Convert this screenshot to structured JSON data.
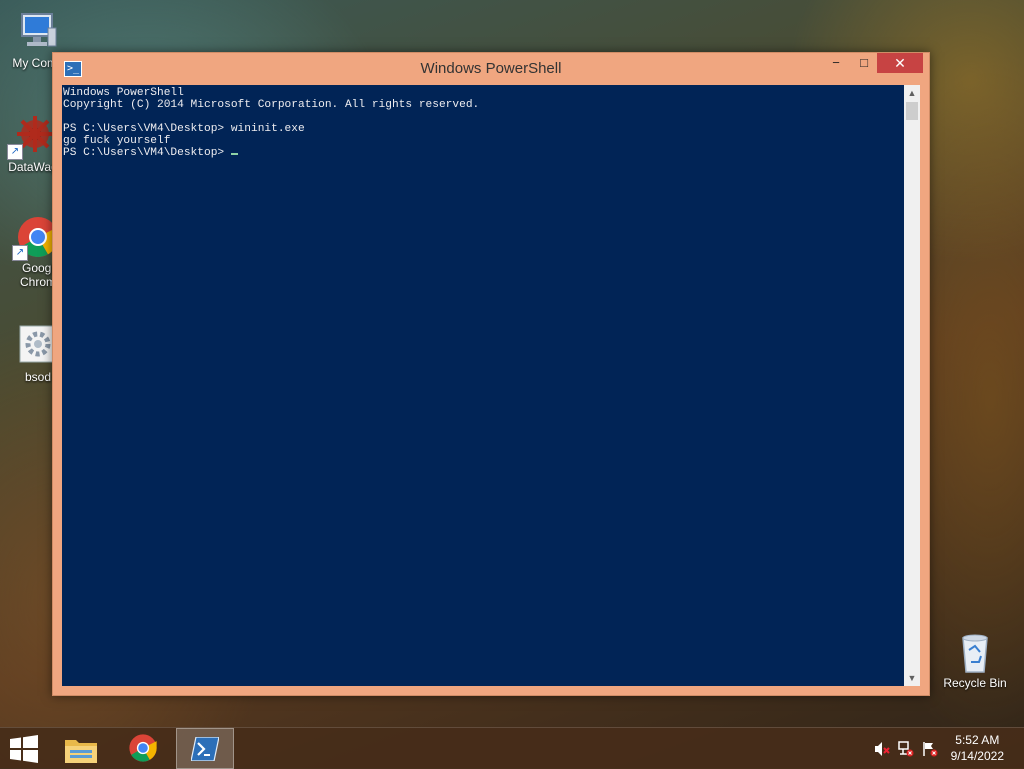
{
  "desktop": {
    "icons": [
      {
        "label": "My Comp",
        "icon": "computer-icon"
      },
      {
        "label": "DataWag",
        "icon": "gear-red-icon"
      },
      {
        "label": "Googl\nChrom",
        "icon": "chrome-icon"
      },
      {
        "label": "bsod",
        "icon": "settings-file-icon"
      },
      {
        "label": "Recycle Bin",
        "icon": "recycle-bin-icon"
      }
    ]
  },
  "window": {
    "title": "Windows PowerShell",
    "controls": {
      "minimize": "−",
      "maximize": "□",
      "close": "✕"
    },
    "console_lines": [
      "Windows PowerShell",
      "Copyright (C) 2014 Microsoft Corporation. All rights reserved.",
      "",
      "PS C:\\Users\\VM4\\Desktop> wininit.exe",
      "go fuck yourself",
      "PS C:\\Users\\VM4\\Desktop> "
    ],
    "colors": {
      "console_bg": "#012456",
      "console_text": "#eeedf0",
      "frame": "#f0a680",
      "close": "#c74343"
    }
  },
  "taskbar": {
    "apps": [
      {
        "name": "File Explorer",
        "icon": "folder-icon",
        "active": false
      },
      {
        "name": "Google Chrome",
        "icon": "chrome-icon",
        "active": false
      },
      {
        "name": "Windows PowerShell",
        "icon": "powershell-icon",
        "active": true
      }
    ],
    "tray": {
      "time": "5:52 AM",
      "date": "9/14/2022",
      "icons": [
        "volume-muted-icon",
        "network-error-icon",
        "action-center-flag-icon"
      ]
    }
  }
}
